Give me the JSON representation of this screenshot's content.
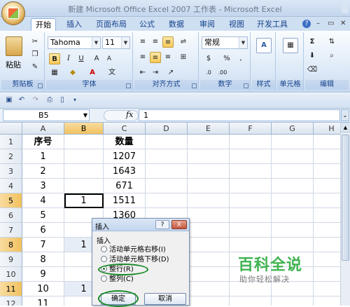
{
  "window": {
    "title": "新建 Microsoft Office Excel 2007 工作表 - Microsoft Excel"
  },
  "ribbon_tabs": [
    "开始",
    "插入",
    "页面布局",
    "公式",
    "数据",
    "审阅",
    "视图",
    "开发工具"
  ],
  "active_tab": "开始",
  "ribbon": {
    "clipboard": {
      "label": "剪贴板",
      "paste": "粘贴"
    },
    "font": {
      "label": "字体",
      "name": "Tahoma",
      "size": "11"
    },
    "alignment": {
      "label": "对齐方式"
    },
    "number": {
      "label": "数字",
      "format": "常规"
    },
    "styles": {
      "label": "样式"
    },
    "cells": {
      "label": "单元格"
    },
    "editing": {
      "label": "编辑"
    }
  },
  "formula_bar": {
    "cell_ref": "B5",
    "fx": "fx",
    "value": "1"
  },
  "grid": {
    "columns": [
      "A",
      "B",
      "C",
      "D",
      "E",
      "F",
      "G",
      "H"
    ],
    "active_column": "B",
    "rows": [
      {
        "num": "1",
        "A": "序号",
        "B": "",
        "C": "数量"
      },
      {
        "num": "2",
        "A": "1",
        "B": "",
        "C": "1207"
      },
      {
        "num": "3",
        "A": "2",
        "B": "",
        "C": "1643"
      },
      {
        "num": "4",
        "A": "3",
        "B": "",
        "C": "671"
      },
      {
        "num": "5",
        "A": "4",
        "B": "1",
        "C": "1511"
      },
      {
        "num": "6",
        "A": "5",
        "B": "",
        "C": "1360"
      },
      {
        "num": "7",
        "A": "6",
        "B": "",
        "C": ""
      },
      {
        "num": "8",
        "A": "7",
        "B": "1",
        "C": ""
      },
      {
        "num": "9",
        "A": "8",
        "B": "",
        "C": ""
      },
      {
        "num": "10",
        "A": "9",
        "B": "",
        "C": ""
      },
      {
        "num": "11",
        "A": "10",
        "B": "1",
        "C": ""
      },
      {
        "num": "12",
        "A": "11",
        "B": "",
        "C": ""
      }
    ],
    "active_rows": [
      "5",
      "8",
      "11"
    ]
  },
  "dialog": {
    "title": "插入",
    "help": "?",
    "close": "X",
    "section_label": "插入",
    "options": [
      "活动单元格右移(I)",
      "活动单元格下移(D)",
      "整行(R)",
      "整列(C)"
    ],
    "selected_option": "整行(R)",
    "ok": "确定",
    "cancel": "取消"
  },
  "watermark": {
    "main": "百科全说",
    "sub": "助你轻松解决"
  }
}
